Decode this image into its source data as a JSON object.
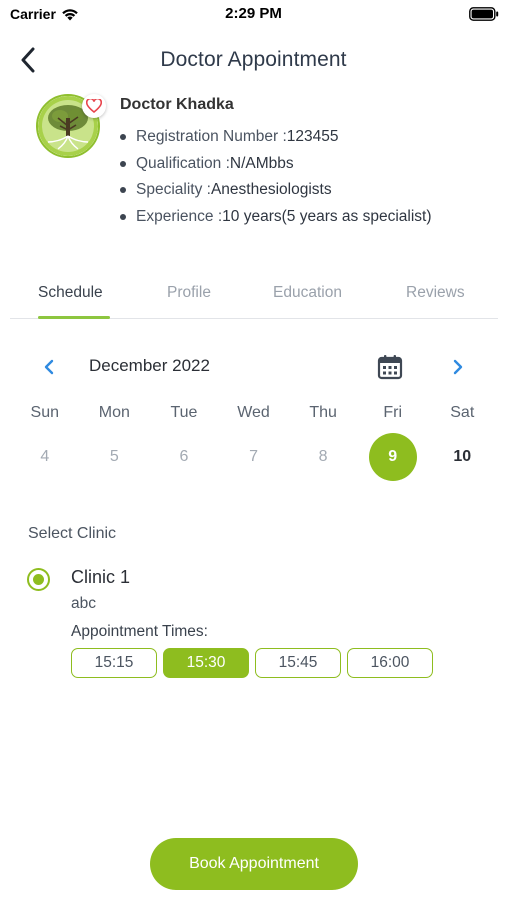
{
  "status_bar": {
    "carrier": "Carrier",
    "time": "2:29 PM"
  },
  "nav": {
    "title": "Doctor Appointment"
  },
  "doctor": {
    "name": "Doctor Khadka",
    "details": [
      {
        "label": "Registration Number : ",
        "value": "123455"
      },
      {
        "label": "Qualification : ",
        "value": "N/AMbbs"
      },
      {
        "label": "Speciality : ",
        "value": "Anesthesiologists"
      },
      {
        "label": "Experience : ",
        "value": "10 years(5 years as specialist)"
      }
    ]
  },
  "tabs": [
    "Schedule",
    "Profile",
    "Education",
    "Reviews"
  ],
  "active_tab": "Schedule",
  "calendar": {
    "month": "December 2022",
    "weekdays": [
      "Sun",
      "Mon",
      "Tue",
      "Wed",
      "Thu",
      "Fri",
      "Sat"
    ],
    "days": [
      "4",
      "5",
      "6",
      "7",
      "8",
      "9",
      "10"
    ],
    "selected_day": "9"
  },
  "clinic": {
    "section_label": "Select Clinic",
    "name": "Clinic 1",
    "description": "abc",
    "times_label": "Appointment Times:",
    "times": [
      "15:15",
      "15:30",
      "15:45",
      "16:00"
    ],
    "selected_time": "15:30"
  },
  "book_button": "Book Appointment",
  "colors": {
    "accent": "#8ebd1f",
    "link_blue": "#2f8ae0",
    "heart_red": "#e8454d"
  }
}
